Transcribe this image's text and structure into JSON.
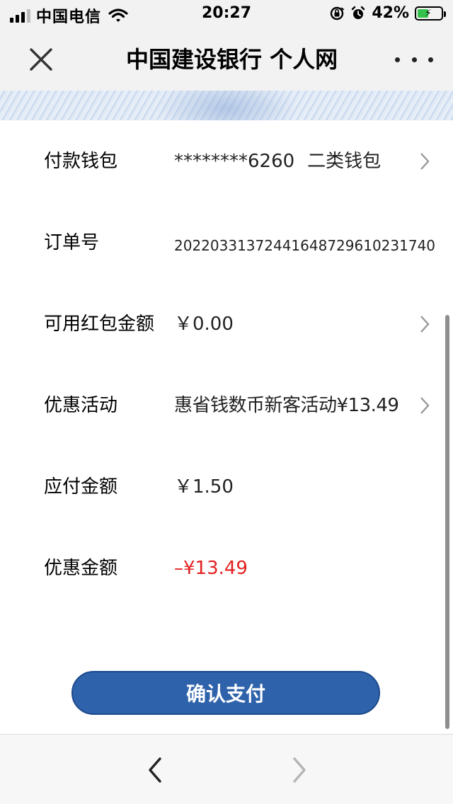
{
  "status_bar": {
    "carrier": "中国电信",
    "time": "20:27",
    "battery_percent": "42%",
    "icons": [
      "signal-icon",
      "wifi-icon",
      "orientation-lock-icon",
      "alarm-icon",
      "battery-charging-icon"
    ]
  },
  "nav": {
    "title": "中国建设银行 个人网",
    "icons": [
      "close-icon",
      "more-icon"
    ]
  },
  "rows": [
    {
      "label": "付款钱包",
      "value": "********6260",
      "extra": "二类钱包",
      "chevron": true
    },
    {
      "label": "订单号",
      "value": "20220331372441648729610231740",
      "chevron": false
    },
    {
      "label": "可用红包金额",
      "value": "￥0.00",
      "chevron": true
    },
    {
      "label": "优惠活动",
      "value": "惠省钱数币新客活动¥13.49",
      "chevron": true
    },
    {
      "label": "应付金额",
      "value": "￥1.50",
      "chevron": false
    },
    {
      "label": "优惠金额",
      "value": "–¥13.49",
      "chevron": false
    }
  ],
  "confirm_button": "确认支付",
  "colors": {
    "accent": "#2e62ab",
    "discount_red": "#e32020",
    "bar_background": "#f2f2f2"
  },
  "toolbar": {
    "icons": [
      "back-arrow-icon",
      "forward-arrow-icon"
    ]
  }
}
